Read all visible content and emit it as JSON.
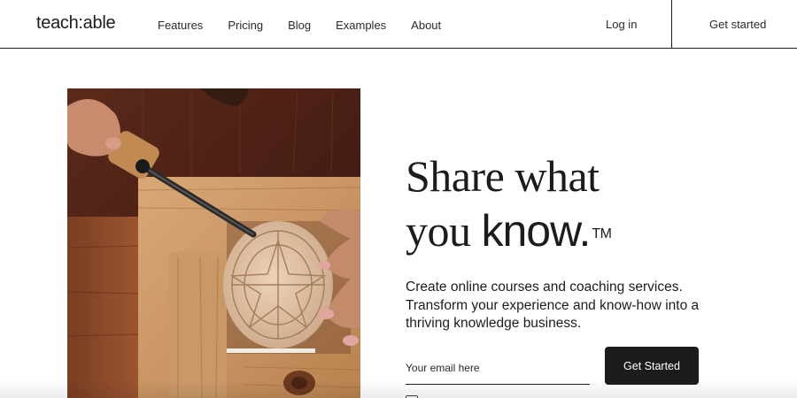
{
  "header": {
    "logo": "teach:able",
    "nav": [
      "Features",
      "Pricing",
      "Blog",
      "Examples",
      "About"
    ],
    "login": "Log in",
    "get_started": "Get started"
  },
  "hero": {
    "headline_line1": "Share what",
    "headline_line2_prefix": "you ",
    "headline_line2_emphasis": "know.",
    "headline_tm": "TM",
    "subtext": "Create online courses and coaching services. Transform your experience and know-how into a thriving knowledge business.",
    "email_placeholder": "Your email here",
    "cta_label": "Get Started"
  },
  "colors": {
    "text": "#1c1c1c",
    "cta_bg": "#1c1c1c",
    "cta_text": "#ffffff",
    "background": "#ffffff"
  }
}
